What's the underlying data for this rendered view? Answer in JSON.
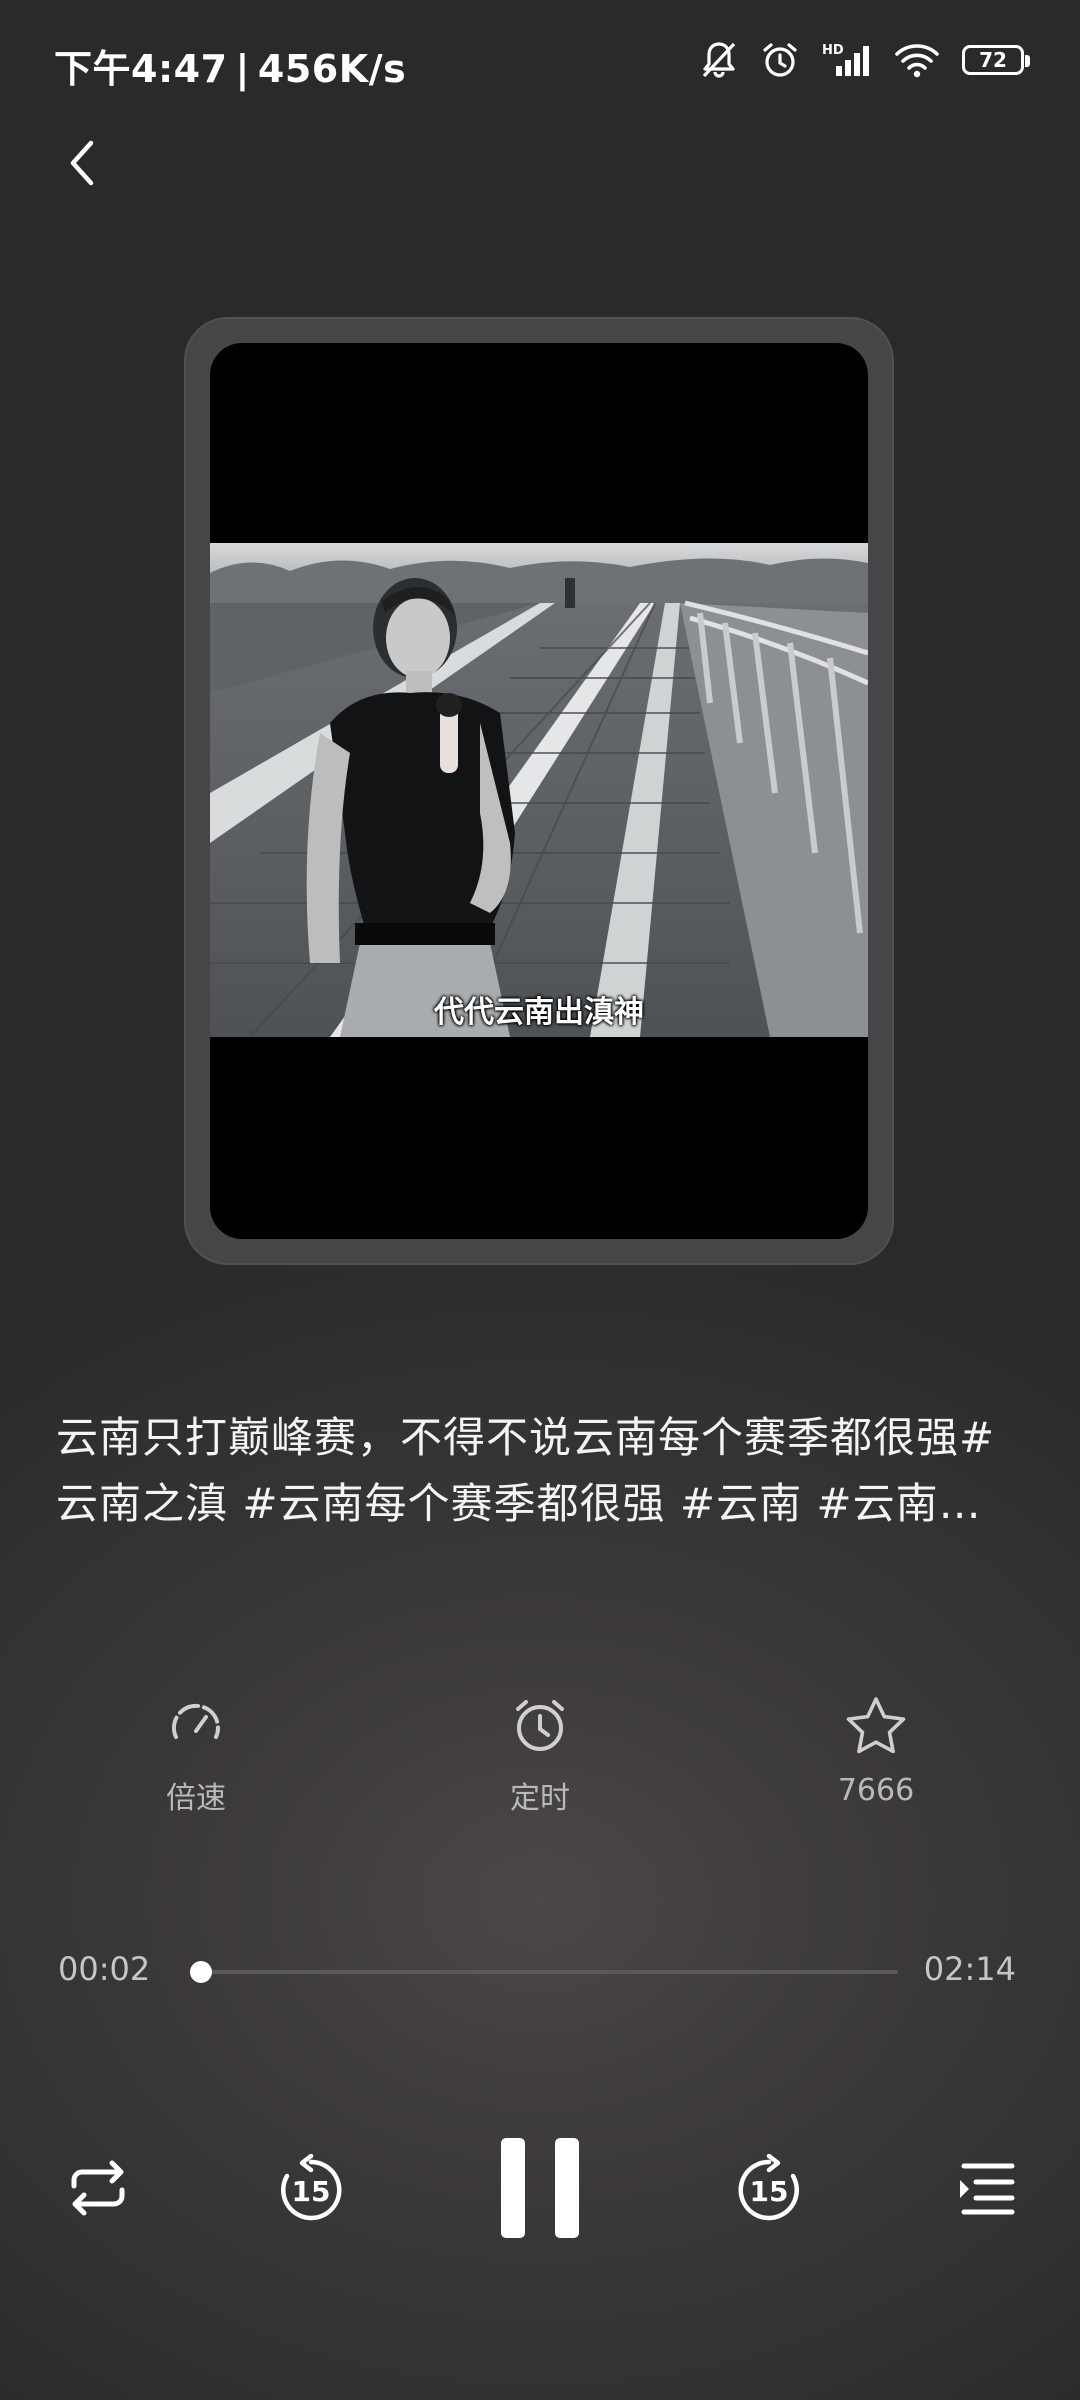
{
  "status_bar": {
    "time": "下午4:47",
    "net_speed": "456K/s",
    "network_badge": "HD",
    "battery": "72",
    "icons": [
      "mute-bell-icon",
      "alarm-icon",
      "signal-icon",
      "wifi-icon",
      "battery-icon"
    ]
  },
  "header": {
    "back_icon": "chevron-left-icon"
  },
  "cover": {
    "subtitle": "代代云南出滇神"
  },
  "track": {
    "title": "云南只打巅峰赛，不得不说云南每个赛季都很强#云南之滇 #云南每个赛季都很强 #云南 #云南人 #云南之光"
  },
  "actions": {
    "speed_label": "倍速",
    "timer_label": "定时",
    "favorite_count": "7666"
  },
  "progress": {
    "current": "00:02",
    "total": "02:14",
    "fraction": 0.015
  },
  "controls": {
    "repeat_icon": "repeat-icon",
    "rewind_icon": "rewind-15-icon",
    "rewind_seconds": "15",
    "play_state": "playing",
    "forward_icon": "forward-15-icon",
    "forward_seconds": "15",
    "playlist_icon": "playlist-icon"
  },
  "colors": {
    "background": "#333232",
    "text": "#f2f2f2",
    "muted": "#b9b9b9",
    "track": "#5a5858"
  }
}
